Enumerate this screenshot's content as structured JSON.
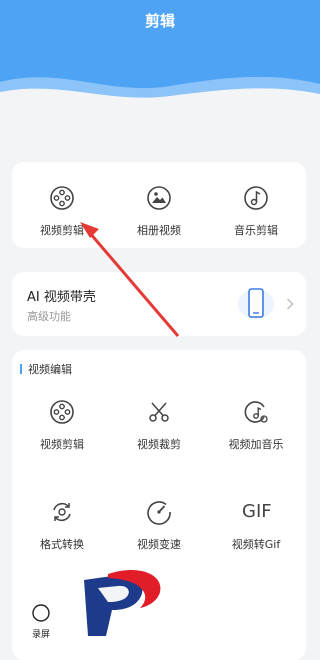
{
  "header": {
    "title": "剪辑",
    "color": "#4fa3f4"
  },
  "quick_tools": [
    {
      "label": "视频剪辑",
      "icon": "film-reel-icon"
    },
    {
      "label": "相册视频",
      "icon": "photo-album-icon"
    },
    {
      "label": "音乐剪辑",
      "icon": "music-note-icon"
    }
  ],
  "ai_banner": {
    "title": "AI 视频带壳",
    "subtitle": "高级功能",
    "icon": "phone-icon"
  },
  "video_edit": {
    "section_title": "视频编辑",
    "tools": [
      {
        "label": "视频剪辑",
        "icon": "film-reel-icon"
      },
      {
        "label": "视频裁剪",
        "icon": "scissors-icon"
      },
      {
        "label": "视频加音乐",
        "icon": "music-clip-icon"
      },
      {
        "label": "格式转换",
        "icon": "convert-icon"
      },
      {
        "label": "视频变速",
        "icon": "speed-icon"
      },
      {
        "label": "视频转Gif",
        "icon": "gif-icon",
        "glyph": "GIF"
      }
    ]
  },
  "bottom_bar": {
    "record_label": "录屏"
  }
}
